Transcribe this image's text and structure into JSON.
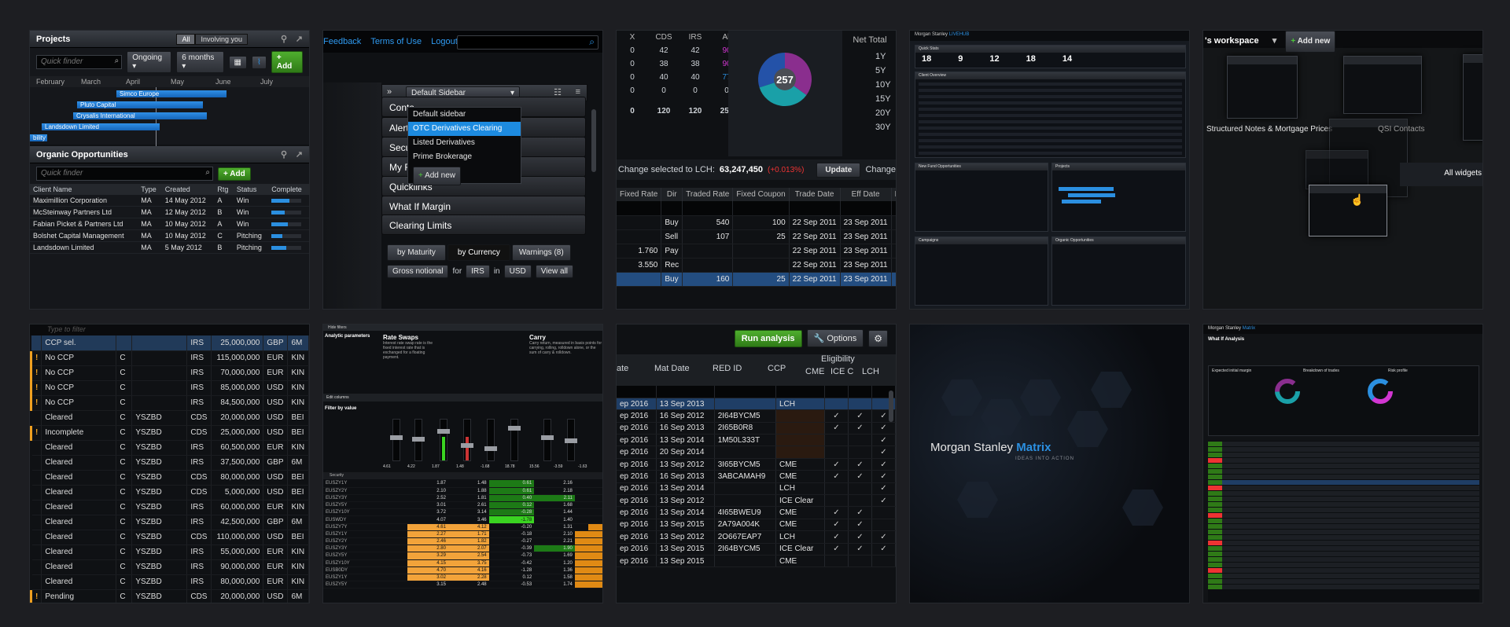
{
  "tile1": {
    "projects_title": "Projects",
    "seg_all": "All",
    "seg_involving": "Involving you",
    "quick_finder": "Quick finder",
    "filter_ongoing": "Ongoing",
    "filter_period": "6 months",
    "add_label": "Add",
    "months": [
      "February",
      "March",
      "April",
      "May",
      "June",
      "July"
    ],
    "gantt": [
      {
        "label": "Simco Europe"
      },
      {
        "label": "Pluto Capital"
      },
      {
        "label": "Crysalis International"
      },
      {
        "label": "Landsdown Limited"
      },
      {
        "label": "bility"
      }
    ],
    "opps_title": "Organic Opportunities",
    "opps_finder": "Quick finder",
    "columns": [
      "Client Name",
      "Type",
      "Created",
      "Rtg",
      "Status",
      "Complete"
    ],
    "rows": [
      {
        "name": "Maximillion Corporation",
        "type": "MA",
        "created": "14 May 2012",
        "rtg": "A",
        "status": "Win",
        "complete": 0.6
      },
      {
        "name": "McSteinway Partners Ltd",
        "type": "MA",
        "created": "12 May 2012",
        "rtg": "B",
        "status": "Win",
        "complete": 0.45
      },
      {
        "name": "Fabian Picket & Partners Ltd",
        "type": "MA",
        "created": "10 May 2012",
        "rtg": "A",
        "status": "Win",
        "complete": 0.55
      },
      {
        "name": "Bolshet Capital Management",
        "type": "MA",
        "created": "10 May 2012",
        "rtg": "C",
        "status": "Pitching",
        "complete": 0.35
      },
      {
        "name": "Landsdown Limited",
        "type": "MA",
        "created": "5 May 2012",
        "rtg": "B",
        "status": "Pitching",
        "complete": 0.5
      }
    ]
  },
  "tile2": {
    "links": [
      "Feedback",
      "Terms of Use",
      "Logout"
    ],
    "sidebar_select": "Default Sidebar",
    "dropdown": [
      "Default sidebar",
      "OTC Derivatives Clearing",
      "Listed Derivatives",
      "Prime Brokerage"
    ],
    "add_new": "Add new",
    "menu": [
      "Conta",
      "Alerts",
      "Secur",
      "My R",
      "Quicklinks",
      "What If Margin",
      "Clearing Limits"
    ],
    "tabs": [
      "by Maturity",
      "by Currency",
      "Warnings (8)"
    ],
    "footer": [
      "Gross notional",
      "for",
      "IRS",
      "in",
      "USD",
      "View all"
    ]
  },
  "tile3": {
    "head": [
      "X",
      "CDS",
      "IRS",
      "All"
    ],
    "matrix": [
      [
        "0",
        "42",
        "42",
        "90"
      ],
      [
        "0",
        "38",
        "38",
        "90"
      ],
      [
        "0",
        "40",
        "40",
        "77"
      ],
      [
        "0",
        "0",
        "0",
        "0"
      ],
      [
        "0",
        "120",
        "120",
        "257"
      ]
    ],
    "pie_total": "257",
    "pie_slices": [
      {
        "value": 90,
        "color": "#8a2e8e"
      },
      {
        "value": 90,
        "color": "#1aa0a8"
      },
      {
        "value": 77,
        "color": "#2452a8"
      }
    ],
    "net_total": "Net Total",
    "tenors": [
      "1Y",
      "5Y",
      "10Y",
      "15Y",
      "20Y",
      "30Y"
    ],
    "change_label": "Change selected to LCH:",
    "change_value": "63,247,450",
    "change_pct": "(+0.013%)",
    "update": "Update",
    "change2": "Change",
    "trade_cols": [
      "Fixed Rate",
      "Dir",
      "Traded Rate",
      "Fixed Coupon",
      "Trade Date",
      "Eff Date",
      "Mat Dat"
    ],
    "trades": [
      [
        "",
        "Buy",
        "540",
        "100",
        "22 Sep 2011",
        "23 Sep 2011",
        "13 Sep"
      ],
      [
        "",
        "Sell",
        "107",
        "25",
        "22 Sep 2011",
        "23 Sep 2011",
        "13 Sep"
      ],
      [
        "1.760",
        "Pay",
        "",
        "",
        "22 Sep 2011",
        "23 Sep 2011",
        "13 Sep"
      ],
      [
        "3.550",
        "Rec",
        "",
        "",
        "22 Sep 2011",
        "23 Sep 2011",
        "13 Sep"
      ],
      [
        "",
        "Buy",
        "160",
        "25",
        "22 Sep 2011",
        "23 Sep 2011",
        "13 Sep"
      ]
    ]
  },
  "tile4": {
    "brand": "Morgan Stanley",
    "brand2": "LIVEHUB",
    "quick_stats": "Quick Stats",
    "stats": [
      "18",
      "9",
      "12",
      "18",
      "14"
    ],
    "client_overview": "Client Overview",
    "new_fund": "New Fund Opportunities",
    "projects": "Projects",
    "campaigns": "Campaigns",
    "organic": "Organic Opportunities"
  },
  "tile5": {
    "workspace": "'s workspace",
    "add_new": "Add new",
    "structured": "Structured Notes & Mortgage Prices",
    "qsi": "QSI Contacts",
    "all_widgets": "All widgets"
  },
  "tile6": {
    "filter": "Type to filter",
    "rows": [
      {
        "flag": "",
        "status": "CCP sel.",
        "cls": "green",
        "c": "",
        "id": "",
        "type": "IRS",
        "amt": "25,000,000",
        "ccy": "GBP",
        "tail": "6M"
      },
      {
        "flag": "!",
        "status": "No CCP",
        "cls": "orange",
        "c": "C",
        "id": "",
        "type": "IRS",
        "amt": "115,000,000",
        "ccy": "EUR",
        "tail": "KIN"
      },
      {
        "flag": "!",
        "status": "No CCP",
        "cls": "orange",
        "c": "C",
        "id": "",
        "type": "IRS",
        "amt": "70,000,000",
        "ccy": "EUR",
        "tail": "KIN"
      },
      {
        "flag": "!",
        "status": "No CCP",
        "cls": "orange",
        "c": "C",
        "id": "",
        "type": "IRS",
        "amt": "85,000,000",
        "ccy": "USD",
        "tail": "KIN"
      },
      {
        "flag": "!",
        "status": "No CCP",
        "cls": "orange",
        "c": "C",
        "id": "",
        "type": "IRS",
        "amt": "84,500,000",
        "ccy": "USD",
        "tail": "KIN"
      },
      {
        "flag": "",
        "status": "Cleared",
        "cls": "green",
        "c": "C",
        "id": "YSZBD",
        "type": "CDS",
        "amt": "20,000,000",
        "ccy": "USD",
        "tail": "BEI"
      },
      {
        "flag": "!",
        "status": "Incomplete",
        "cls": "red",
        "c": "C",
        "id": "YSZBD",
        "type": "CDS",
        "amt": "25,000,000",
        "ccy": "USD",
        "tail": "BEI"
      },
      {
        "flag": "",
        "status": "Cleared",
        "cls": "green",
        "c": "C",
        "id": "YSZBD",
        "type": "IRS",
        "amt": "60,500,000",
        "ccy": "EUR",
        "tail": "KIN"
      },
      {
        "flag": "",
        "status": "Cleared",
        "cls": "green",
        "c": "C",
        "id": "YSZBD",
        "type": "IRS",
        "amt": "37,500,000",
        "ccy": "GBP",
        "tail": "6M"
      },
      {
        "flag": "",
        "status": "Cleared",
        "cls": "green",
        "c": "C",
        "id": "YSZBD",
        "type": "CDS",
        "amt": "80,000,000",
        "ccy": "USD",
        "tail": "BEI"
      },
      {
        "flag": "",
        "status": "Cleared",
        "cls": "green",
        "c": "C",
        "id": "YSZBD",
        "type": "CDS",
        "amt": "5,000,000",
        "ccy": "USD",
        "tail": "BEI"
      },
      {
        "flag": "",
        "status": "Cleared",
        "cls": "green",
        "c": "C",
        "id": "YSZBD",
        "type": "IRS",
        "amt": "60,000,000",
        "ccy": "EUR",
        "tail": "KIN"
      },
      {
        "flag": "",
        "status": "Cleared",
        "cls": "green",
        "c": "C",
        "id": "YSZBD",
        "type": "IRS",
        "amt": "42,500,000",
        "ccy": "GBP",
        "tail": "6M"
      },
      {
        "flag": "",
        "status": "Cleared",
        "cls": "green",
        "c": "C",
        "id": "YSZBD",
        "type": "CDS",
        "amt": "110,000,000",
        "ccy": "USD",
        "tail": "BEI"
      },
      {
        "flag": "",
        "status": "Cleared",
        "cls": "green",
        "c": "C",
        "id": "YSZBD",
        "type": "IRS",
        "amt": "55,000,000",
        "ccy": "EUR",
        "tail": "KIN"
      },
      {
        "flag": "",
        "status": "Cleared",
        "cls": "green",
        "c": "C",
        "id": "YSZBD",
        "type": "IRS",
        "amt": "90,000,000",
        "ccy": "EUR",
        "tail": "KIN"
      },
      {
        "flag": "",
        "status": "Cleared",
        "cls": "green",
        "c": "C",
        "id": "YSZBD",
        "type": "IRS",
        "amt": "80,000,000",
        "ccy": "EUR",
        "tail": "KIN"
      },
      {
        "flag": "!",
        "status": "Pending",
        "cls": "orange",
        "c": "C",
        "id": "YSZBD",
        "type": "CDS",
        "amt": "20,000,000",
        "ccy": "USD",
        "tail": "6M"
      }
    ]
  },
  "tile7": {
    "hide_filters": "Hide filters",
    "analytic": "Analytic parameters",
    "rate_swaps": "Rate Swaps",
    "carry": "Carry",
    "rate_text": "Interest rate swap rate is the fixed interest rate that is exchanged for a floating payment.",
    "carry_text": "Carry return, measured in basis points for carrying, rolling, rolldown alone, or the sum of carry & rolldown.",
    "edit_columns": "Edit columns",
    "filter_by_value": "Filter by value",
    "col_heads": [
      "Rate level",
      "Historical Avg",
      "1m change",
      "Z-score",
      "Carry",
      "Historical Avg"
    ],
    "vals_top": [
      "4.61",
      "4.22",
      "1.87",
      "1.48",
      "-1.68",
      "18.78",
      "15.56",
      "-3.59",
      "-1.63"
    ],
    "security": "Security",
    "table_heads": [
      "Rate level",
      "6m Historical Avg",
      "1m Change",
      "6m Z-score",
      "6m Carry & rolldown",
      "6m Carry average"
    ],
    "rows": [
      [
        "EUSZY1Y",
        "1.87",
        "1.48",
        "0.61",
        "2.16",
        "",
        ""
      ],
      [
        "EUSZY2Y",
        "2.10",
        "1.88",
        "0.61",
        "2.18",
        "",
        ""
      ],
      [
        "EUSZY3Y",
        "2.52",
        "1.81",
        "0.40",
        "2.11",
        "",
        ""
      ],
      [
        "EUSZY5Y",
        "3.01",
        "2.61",
        "0.12",
        "1.68",
        "",
        ""
      ],
      [
        "EUSZY10Y",
        "3.72",
        "3.14",
        "-0.28",
        "1.44",
        "",
        ""
      ],
      [
        "EUSWDY",
        "4.07",
        "3.46",
        "-1.78",
        "1.40",
        "",
        ""
      ],
      [
        "EUSZY7Y",
        "4.61",
        "4.12",
        "-0.20",
        "1.31",
        "",
        ""
      ],
      [
        "EUSZY1Y",
        "2.27",
        "1.71",
        "-0.18",
        "2.10",
        "",
        ""
      ],
      [
        "EUSZY2Y",
        "2.46",
        "1.82",
        "-0.27",
        "2.21",
        "",
        ""
      ],
      [
        "EUSZY3Y",
        "2.80",
        "2.07",
        "-0.39",
        "1.90",
        "",
        ""
      ],
      [
        "EUSZY5Y",
        "3.29",
        "2.54",
        "-0.73",
        "1.69",
        "",
        ""
      ],
      [
        "EUSZY10Y",
        "4.15",
        "3.75",
        "-0.42",
        "1.20",
        "",
        ""
      ],
      [
        "EUSB0DY",
        "4.70",
        "4.16",
        "-1.28",
        "1.36",
        "",
        ""
      ],
      [
        "EUSZY1Y",
        "3.02",
        "2.28",
        "0.12",
        "1.58",
        "",
        ""
      ],
      [
        "EUSZY5Y",
        "3.15",
        "2.48",
        "-0.53",
        "1.74",
        "",
        ""
      ]
    ]
  },
  "tile8": {
    "run_analysis": "Run analysis",
    "options": "Options",
    "cols": [
      "ate",
      "Mat Date",
      "RED ID",
      "CCP",
      "Eligibility"
    ],
    "elig_cols": [
      "CME",
      "ICE C",
      "LCH"
    ],
    "rows": [
      [
        "ep 2016",
        "13 Sep 2013",
        "",
        "LCH",
        "",
        "",
        ""
      ],
      [
        "ep 2016",
        "16 Sep 2012",
        "2I64BYCM5",
        "",
        "✓",
        "✓",
        "✓"
      ],
      [
        "ep 2016",
        "16 Sep 2013",
        "2I65B0R8",
        "",
        "✓",
        "✓",
        "✓"
      ],
      [
        "ep 2016",
        "13 Sep 2014",
        "1M50L333T",
        "",
        "",
        "",
        "✓"
      ],
      [
        "ep 2016",
        "20 Sep 2014",
        "",
        "",
        "",
        "",
        "✓"
      ],
      [
        "ep 2016",
        "13 Sep 2012",
        "3I65BYCM5",
        "CME",
        "✓",
        "✓",
        "✓"
      ],
      [
        "ep 2016",
        "16 Sep 2013",
        "3ABCAMAH9",
        "CME",
        "✓",
        "✓",
        "✓"
      ],
      [
        "ep 2016",
        "13 Sep 2014",
        "",
        "LCH",
        "",
        "",
        "✓"
      ],
      [
        "ep 2016",
        "13 Sep 2012",
        "",
        "ICE Clear",
        "",
        "",
        "✓"
      ],
      [
        "ep 2016",
        "13 Sep 2014",
        "4I65BWEU9",
        "CME",
        "✓",
        "✓",
        ""
      ],
      [
        "ep 2016",
        "13 Sep 2015",
        "2A79A004K",
        "CME",
        "✓",
        "✓",
        ""
      ],
      [
        "ep 2016",
        "13 Sep 2012",
        "2O667EAP7",
        "LCH",
        "✓",
        "✓",
        "✓"
      ],
      [
        "ep 2016",
        "13 Sep 2015",
        "2I64BYCM5",
        "ICE Clear",
        "✓",
        "✓",
        "✓"
      ],
      [
        "ep 2016",
        "13 Sep 2015",
        "",
        "CME",
        "",
        "",
        ""
      ]
    ]
  },
  "tile9": {
    "brand": "Morgan Stanley",
    "product": "Matrix",
    "tagline": "IDEAS INTO ACTION"
  },
  "tile10": {
    "brand": "Morgan Stanley",
    "product": "Matrix",
    "what_if": "What If Analysis",
    "expected": "Expected initial margin",
    "breakdown": "Breakdown of trades",
    "risk": "Risk profile"
  }
}
